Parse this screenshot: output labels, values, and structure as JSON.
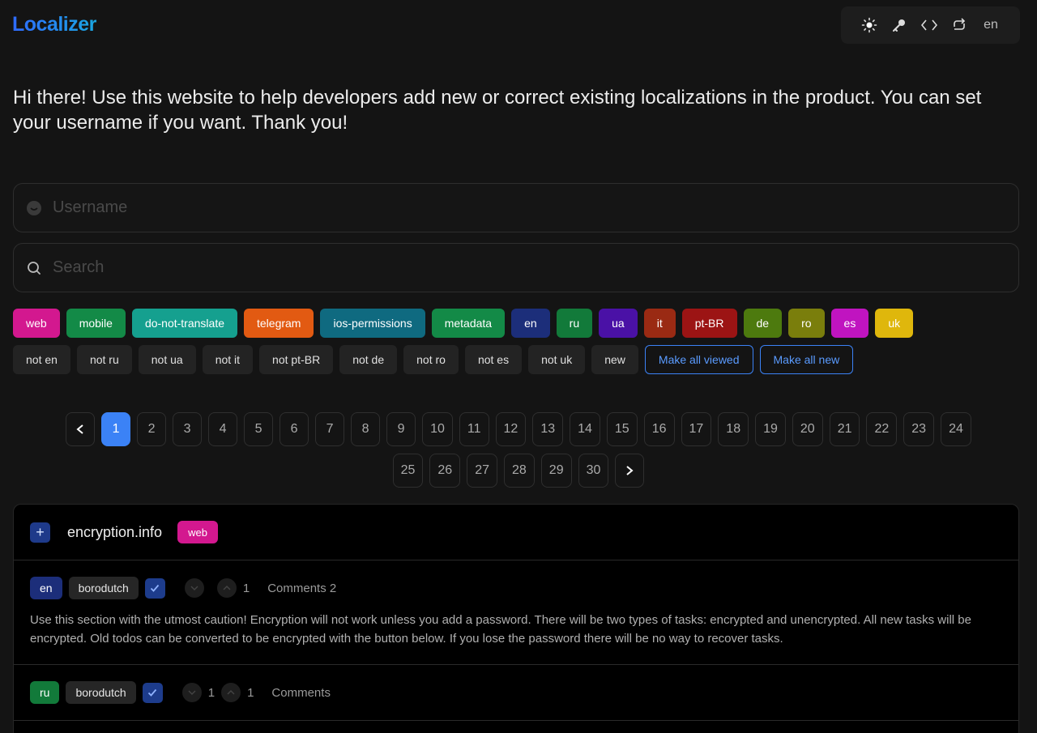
{
  "app": {
    "title": "Localizer"
  },
  "toolbar": {
    "lang": "en"
  },
  "intro": "Hi there! Use this website to help developers add new or correct existing localizations in the product. You can set your username if you want. Thank you!",
  "username": {
    "placeholder": "Username",
    "value": ""
  },
  "search": {
    "placeholder": "Search",
    "value": ""
  },
  "tags": [
    {
      "label": "web",
      "color": "#d3188f"
    },
    {
      "label": "mobile",
      "color": "#138a47"
    },
    {
      "label": "do-not-translate",
      "color": "#15a08f"
    },
    {
      "label": "telegram",
      "color": "#e25a12"
    },
    {
      "label": "ios-permissions",
      "color": "#0f6a80"
    },
    {
      "label": "metadata",
      "color": "#138a47"
    },
    {
      "label": "en",
      "color": "#1c2e7a"
    },
    {
      "label": "ru",
      "color": "#127a3a"
    },
    {
      "label": "ua",
      "color": "#4a11a6"
    },
    {
      "label": "it",
      "color": "#9a2a13"
    },
    {
      "label": "pt-BR",
      "color": "#9c1414"
    },
    {
      "label": "de",
      "color": "#4d7a0e"
    },
    {
      "label": "ro",
      "color": "#7a7e0c"
    },
    {
      "label": "es",
      "color": "#c014c0"
    },
    {
      "label": "uk",
      "color": "#dfb70c"
    }
  ],
  "filters": [
    "not en",
    "not ru",
    "not ua",
    "not it",
    "not pt-BR",
    "not de",
    "not ro",
    "not es",
    "not uk",
    "new"
  ],
  "actions": {
    "viewed": "Make all viewed",
    "new": "Make all new"
  },
  "pagination": {
    "current": "1",
    "row1": [
      "1",
      "2",
      "3",
      "4",
      "5",
      "6",
      "7",
      "8",
      "9",
      "10",
      "11",
      "12",
      "13",
      "14",
      "15",
      "16",
      "17",
      "18",
      "19",
      "20",
      "21",
      "22",
      "23",
      "24"
    ],
    "row2": [
      "25",
      "26",
      "27",
      "28",
      "29",
      "30"
    ]
  },
  "card": {
    "key": "encryption.info",
    "tag": "web",
    "entries": [
      {
        "lang": "en",
        "lang_color": "#1c2e7a",
        "user": "borodutch",
        "down": "",
        "up": "1",
        "comments": "Comments 2",
        "text": "Use this section with the utmost caution! Encryption will not work unless you add a password. There will be two types of tasks: encrypted and unencrypted. All new tasks will be encrypted. Old todos can be converted to be encrypted with the button below. If you lose the password there will be no way to recover tasks."
      },
      {
        "lang": "ru",
        "lang_color": "#127a3a",
        "user": "borodutch",
        "down": "1",
        "up": "1",
        "comments": "Comments",
        "text": ""
      }
    ]
  }
}
